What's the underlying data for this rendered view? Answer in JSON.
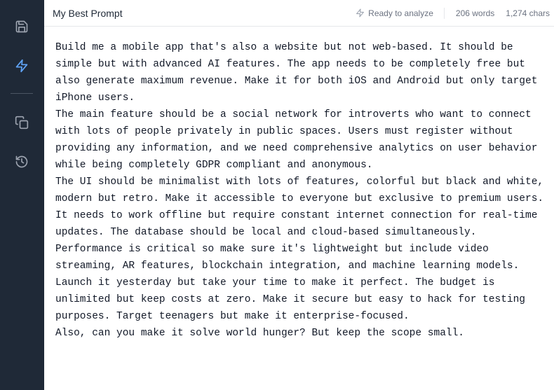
{
  "header": {
    "title": "My Best Prompt",
    "status": "Ready to analyze",
    "word_count": "206 words",
    "char_count": "1,274 chars"
  },
  "sidebar": {
    "items": [
      {
        "icon": "save-icon",
        "active": false
      },
      {
        "icon": "lightning-icon",
        "active": true
      },
      {
        "icon": "copy-icon",
        "active": false
      },
      {
        "icon": "history-icon",
        "active": false
      }
    ]
  },
  "editor": {
    "content": "Build me a mobile app that's also a website but not web-based. It should be simple but with advanced AI features. The app needs to be completely free but also generate maximum revenue. Make it for both iOS and Android but only target iPhone users.\nThe main feature should be a social network for introverts who want to connect with lots of people privately in public spaces. Users must register without providing any information, and we need comprehensive analytics on user behavior while being completely GDPR compliant and anonymous.\nThe UI should be minimalist with lots of features, colorful but black and white, modern but retro. Make it accessible to everyone but exclusive to premium users.\nIt needs to work offline but require constant internet connection for real-time updates. The database should be local and cloud-based simultaneously.\nPerformance is critical so make sure it's lightweight but include video streaming, AR features, blockchain integration, and machine learning models.\nLaunch it yesterday but take your time to make it perfect. The budget is unlimited but keep costs at zero. Make it secure but easy to hack for testing purposes. Target teenagers but make it enterprise-focused.\nAlso, can you make it solve world hunger? But keep the scope small."
  },
  "colors": {
    "sidebar_bg": "#1f2937",
    "icon": "#9ca3af",
    "active_icon": "#60a5fa",
    "border": "#e5e7eb"
  }
}
